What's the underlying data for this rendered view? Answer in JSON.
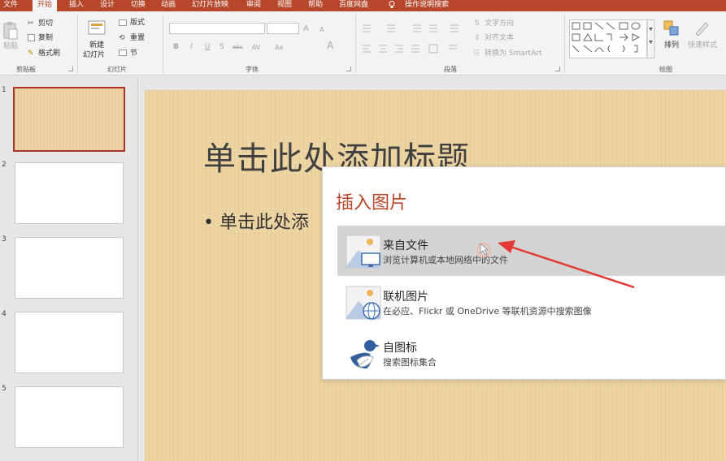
{
  "ribbon_tabs": [
    "文件",
    "开始",
    "插入",
    "设计",
    "切换",
    "动画",
    "幻灯片放映",
    "审阅",
    "视图",
    "帮助",
    "百度网盘",
    "操作说明搜索"
  ],
  "active_tab": "开始",
  "clipboard": {
    "paste": "粘贴",
    "cut": "剪切",
    "copy": "复制",
    "format_painter": "格式刷",
    "group_label": "剪贴板"
  },
  "slides_group": {
    "new_slide_line1": "新建",
    "new_slide_line2": "幻灯片",
    "layout": "版式",
    "reset": "重置",
    "section": "节",
    "group_label": "幻灯片"
  },
  "font_group": {
    "bold": "B",
    "italic": "I",
    "underline": "U",
    "shadow": "S",
    "strike": "abc",
    "char_spacing": "AV",
    "case": "Aa",
    "font_color": "A",
    "grow": "A",
    "shrink": "A",
    "group_label": "字体"
  },
  "paragraph_group": {
    "text_direction": "文字方向",
    "align_text": "对齐文本",
    "convert_smartart": "转换为 SmartArt",
    "group_label": "段落"
  },
  "drawing_group": {
    "arrange": "排列",
    "quick_styles": "快速样式",
    "group_label": "绘图"
  },
  "slide_numbers": [
    "1",
    "2",
    "3",
    "4",
    "5"
  ],
  "slide": {
    "title_placeholder": "单击此处添加标题",
    "bullet_placeholder": "• 单击此处添"
  },
  "dialog": {
    "title": "插入图片",
    "options": [
      {
        "label": "来自文件",
        "desc": "浏览计算机或本地网络中的文件"
      },
      {
        "label": "联机图片",
        "desc": "在必应、Flickr 或 OneDrive 等联机资源中搜索图像"
      },
      {
        "label": "自图标",
        "desc": "搜索图标集合"
      }
    ]
  },
  "colors": {
    "accent": "#b7472a",
    "slide_bg": "#eed6a4",
    "annotation_arrow": "#e53935"
  },
  "icons": {
    "from_file": "picture-with-monitor-icon",
    "online_pictures": "picture-with-globe-icon",
    "icons": "bird-leaf-icon",
    "annotation": "red-arrow"
  }
}
